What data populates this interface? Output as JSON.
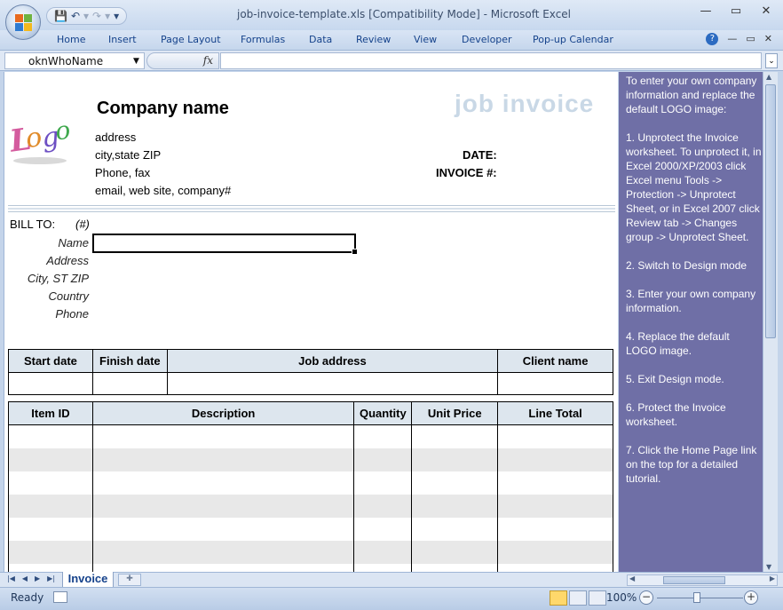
{
  "window": {
    "title": "job-invoice-template.xls  [Compatibility Mode] - Microsoft Excel",
    "controls": [
      "—",
      "▭",
      "✕"
    ],
    "doc_controls": [
      "—",
      "▭",
      "✕"
    ]
  },
  "qat": {
    "save": "💾",
    "undo": "↶",
    "redo": "↷",
    "more": "▾"
  },
  "ribbon": {
    "tabs": [
      "Home",
      "Insert",
      "Page Layout",
      "Formulas",
      "Data",
      "Review",
      "View",
      "Developer",
      "Pop-up Calendar"
    ],
    "help": "?"
  },
  "formula_bar": {
    "name_box": "oknWhoName",
    "fx": "fx",
    "value": ""
  },
  "invoice": {
    "company_name": "Company name",
    "doc_title": "job invoice",
    "address_lines": [
      "address",
      "city,state ZIP",
      "Phone, fax",
      "email, web site, company#"
    ],
    "date_label": "DATE:",
    "invoice_label": "INVOICE #:",
    "bill_to": "BILL TO:",
    "bill_to_hash": "(#)",
    "bill_fields": [
      "Name",
      "Address",
      "City, ST ZIP",
      "Country",
      "Phone"
    ],
    "job_headers": [
      "Start date",
      "Finish date",
      "Job address",
      "Client name"
    ],
    "item_headers": [
      "Item ID",
      "Description",
      "Quantity",
      "Unit Price",
      "Line Total"
    ]
  },
  "panel": {
    "intro": "To enter your own company information and replace the default LOGO image:",
    "steps": [
      "1. Unprotect the Invoice worksheet. To unprotect it, in Excel 2000/XP/2003 click Excel menu Tools -> Protection -> Unprotect Sheet, or in Excel 2007 click Review tab -> Changes group -> Unprotect Sheet.",
      "2. Switch to Design mode",
      "3. Enter your own company information.",
      "4. Replace the default LOGO image.",
      "5. Exit Design mode.",
      "6. Protect the Invoice worksheet.",
      "7. Click the Home Page link on the top for a detailed tutorial."
    ]
  },
  "sheet_tabs": {
    "active": "Invoice"
  },
  "status_bar": {
    "ready": "Ready",
    "zoom": "100%",
    "zoom_level": 1.0
  },
  "colors": {
    "panel_bg": "#6f6fa6",
    "header_fill": "#dde6ee",
    "title_watermark": "#c9d8e6"
  }
}
